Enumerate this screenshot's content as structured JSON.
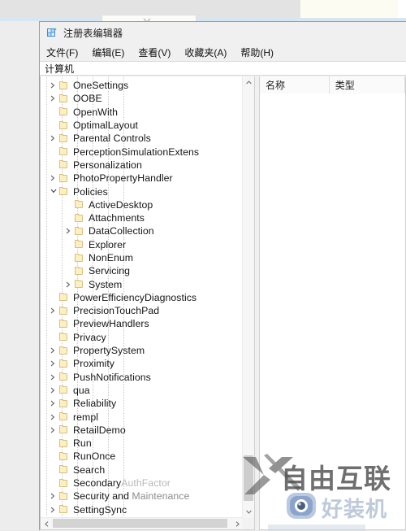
{
  "window": {
    "title": "注册表编辑器",
    "icon": "registry-editor-icon"
  },
  "menu": {
    "items": [
      {
        "label": "文件(F)",
        "name": "menu-file"
      },
      {
        "label": "编辑(E)",
        "name": "menu-edit"
      },
      {
        "label": "查看(V)",
        "name": "menu-view"
      },
      {
        "label": "收藏夹(A)",
        "name": "menu-favorites"
      },
      {
        "label": "帮助(H)",
        "name": "menu-help"
      }
    ]
  },
  "address": {
    "value": "计算机"
  },
  "list_pane": {
    "columns": [
      {
        "label": "名称"
      },
      {
        "label": "类型"
      }
    ],
    "rows": []
  },
  "tree": {
    "items": [
      {
        "label": "OneSettings",
        "depth": 1,
        "state": "collapsed"
      },
      {
        "label": "OOBE",
        "depth": 1,
        "state": "collapsed"
      },
      {
        "label": "OpenWith",
        "depth": 1,
        "state": "leaf"
      },
      {
        "label": "OptimalLayout",
        "depth": 1,
        "state": "leaf"
      },
      {
        "label": "Parental Controls",
        "depth": 1,
        "state": "collapsed"
      },
      {
        "label": "PerceptionSimulationExtens",
        "depth": 1,
        "state": "leaf"
      },
      {
        "label": "Personalization",
        "depth": 1,
        "state": "leaf"
      },
      {
        "label": "PhotoPropertyHandler",
        "depth": 1,
        "state": "collapsed"
      },
      {
        "label": "Policies",
        "depth": 1,
        "state": "expanded"
      },
      {
        "label": "ActiveDesktop",
        "depth": 2,
        "state": "leaf"
      },
      {
        "label": "Attachments",
        "depth": 2,
        "state": "leaf"
      },
      {
        "label": "DataCollection",
        "depth": 2,
        "state": "collapsed"
      },
      {
        "label": "Explorer",
        "depth": 2,
        "state": "leaf"
      },
      {
        "label": "NonEnum",
        "depth": 2,
        "state": "leaf"
      },
      {
        "label": "Servicing",
        "depth": 2,
        "state": "leaf"
      },
      {
        "label": "System",
        "depth": 2,
        "state": "collapsed"
      },
      {
        "label": "PowerEfficiencyDiagnostics",
        "depth": 1,
        "state": "leaf"
      },
      {
        "label": "PrecisionTouchPad",
        "depth": 1,
        "state": "collapsed"
      },
      {
        "label": "PreviewHandlers",
        "depth": 1,
        "state": "leaf"
      },
      {
        "label": "Privacy",
        "depth": 1,
        "state": "leaf"
      },
      {
        "label": "PropertySystem",
        "depth": 1,
        "state": "collapsed"
      },
      {
        "label": "Proximity",
        "depth": 1,
        "state": "collapsed"
      },
      {
        "label": "PushNotifications",
        "depth": 1,
        "state": "collapsed"
      },
      {
        "label": "qua",
        "depth": 1,
        "state": "collapsed"
      },
      {
        "label": "Reliability",
        "depth": 1,
        "state": "collapsed"
      },
      {
        "label": "rempl",
        "depth": 1,
        "state": "collapsed"
      },
      {
        "label": "RetailDemo",
        "depth": 1,
        "state": "collapsed"
      },
      {
        "label": "Run",
        "depth": 1,
        "state": "leaf"
      },
      {
        "label": "RunOnce",
        "depth": 1,
        "state": "leaf"
      },
      {
        "label": "Search",
        "depth": 1,
        "state": "leaf"
      },
      {
        "label": "SecondaryAuthFactor",
        "depth": 1,
        "state": "leaf"
      },
      {
        "label": "Security and Maintenance",
        "depth": 1,
        "state": "collapsed"
      },
      {
        "label": "SettingSync",
        "depth": 1,
        "state": "collapsed"
      }
    ]
  },
  "scrollbars": {
    "vertical": {
      "up_arrow": "chevron-up-icon",
      "down_arrow": "chevron-down-icon"
    },
    "horizontal": {
      "left_arrow": "chevron-left-icon",
      "right_arrow": "chevron-right-icon"
    }
  },
  "watermarks": {
    "primary": "自由互联",
    "secondary": "好装机"
  },
  "colors": {
    "window_border": "#7aa5c8",
    "folder_fill": "#fbefc3",
    "folder_border": "#d9c07e",
    "desktop_bg": "#e9e9e9"
  }
}
